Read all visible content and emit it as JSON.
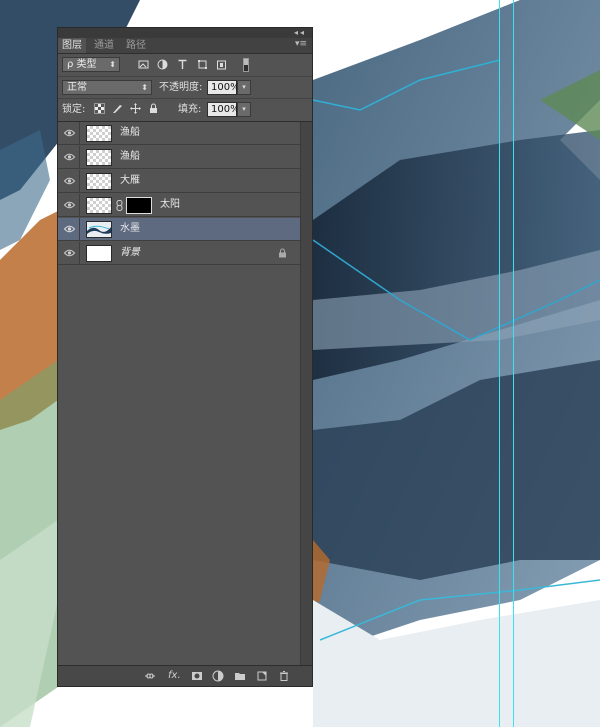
{
  "panel": {
    "tabs": [
      {
        "label": "图层",
        "active": true
      },
      {
        "label": "通道",
        "active": false
      },
      {
        "label": "路径",
        "active": false
      }
    ],
    "collapse_icon": "double-chevron-icon",
    "menu_icon": "panel-menu-icon",
    "filter": {
      "label": "ρ 类型"
    },
    "blend_mode": "正常",
    "opacity": {
      "label": "不透明度:",
      "value": "100%"
    },
    "lock": {
      "label": "锁定:"
    },
    "fill": {
      "label": "填充:",
      "value": "100%"
    }
  },
  "layers": [
    {
      "name": "渔船",
      "thumb": "transparent",
      "selected": false
    },
    {
      "name": "渔船",
      "thumb": "transparent",
      "selected": false
    },
    {
      "name": "大雁",
      "thumb": "transparent",
      "selected": false
    },
    {
      "name": "太阳",
      "thumb": "transparent",
      "mask": true,
      "selected": false
    },
    {
      "name": "水墨",
      "thumb": "ink",
      "selected": true
    },
    {
      "name": "背景",
      "thumb": "white",
      "locked": true,
      "italic": true,
      "selected": false
    }
  ],
  "bottom_bar": {
    "fx_label": "fx."
  },
  "colors": {
    "panel_bg": "#535353",
    "selected_row": "#5d6a80",
    "guide": "#3de0f0",
    "ink_blue": "#1f3c5a",
    "ink_orange": "#b86a2a",
    "ink_green": "#4f8f5a"
  }
}
